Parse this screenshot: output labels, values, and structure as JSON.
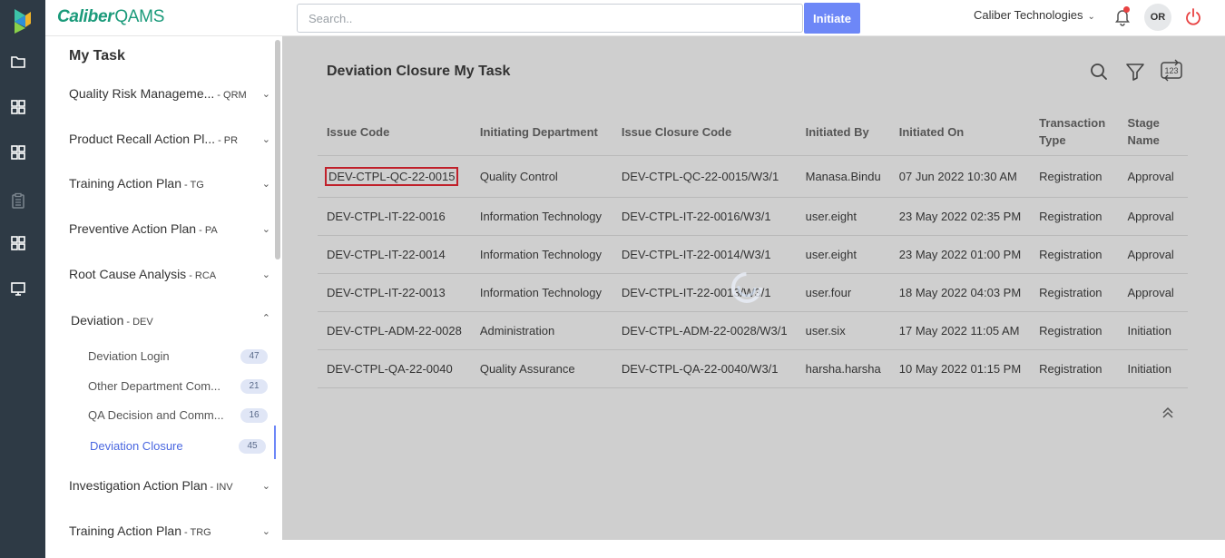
{
  "app": {
    "brand_main": "Caliber",
    "brand_sub": "QAMS"
  },
  "header": {
    "search_placeholder": "Search..",
    "initiate_label": "Initiate",
    "company": "Caliber Technologies",
    "avatar_initials": "OR"
  },
  "rail": {
    "icons": [
      "folder-icon",
      "grid-icon",
      "grid-icon",
      "clipboard-icon",
      "grid-icon",
      "monitor-icon"
    ]
  },
  "sidebar": {
    "title": "My Task",
    "modules": [
      {
        "label": "Quality Risk Manageme...",
        "abbr": "- QRM"
      },
      {
        "label": "Product Recall Action Pl...",
        "abbr": "- PR"
      },
      {
        "label": "Training Action Plan",
        "abbr": "- TG"
      },
      {
        "label": "Preventive Action Plan",
        "abbr": "- PA"
      },
      {
        "label": "Root Cause Analysis",
        "abbr": "- RCA"
      },
      {
        "label": "Deviation",
        "abbr": "- DEV"
      },
      {
        "label": "Investigation Action Plan",
        "abbr": "- INV"
      },
      {
        "label": "Training Action Plan",
        "abbr": "- TRG"
      }
    ],
    "deviation_items": [
      {
        "label": "Deviation Login",
        "count": "47"
      },
      {
        "label": "Other Department Com...",
        "count": "21"
      },
      {
        "label": "QA Decision and Comm...",
        "count": "16"
      },
      {
        "label": "Deviation Closure",
        "count": "45"
      }
    ]
  },
  "main": {
    "title": "Deviation Closure My Task",
    "columns": [
      "Issue Code",
      "Initiating Department",
      "Issue Closure Code",
      "Initiated By",
      "Initiated On",
      "Transaction Type",
      "Stage Name"
    ],
    "rows": [
      [
        "DEV-CTPL-QC-22-0015",
        "Quality Control",
        "DEV-CTPL-QC-22-0015/W3/1",
        "Manasa.Bindu",
        "07 Jun 2022 10:30 AM",
        "Registration",
        "Approval"
      ],
      [
        "DEV-CTPL-IT-22-0016",
        "Information Technology",
        "DEV-CTPL-IT-22-0016/W3/1",
        "user.eight",
        "23 May 2022 02:35 PM",
        "Registration",
        "Approval"
      ],
      [
        "DEV-CTPL-IT-22-0014",
        "Information Technology",
        "DEV-CTPL-IT-22-0014/W3/1",
        "user.eight",
        "23 May 2022 01:00 PM",
        "Registration",
        "Approval"
      ],
      [
        "DEV-CTPL-IT-22-0013",
        "Information Technology",
        "DEV-CTPL-IT-22-0013/W3/1",
        "user.four",
        "18 May 2022 04:03 PM",
        "Registration",
        "Approval"
      ],
      [
        "DEV-CTPL-ADM-22-0028",
        "Administration",
        "DEV-CTPL-ADM-22-0028/W3/1",
        "user.six",
        "17 May 2022 11:05 AM",
        "Registration",
        "Initiation"
      ],
      [
        "DEV-CTPL-QA-22-0040",
        "Quality Assurance",
        "DEV-CTPL-QA-22-0040/W3/1",
        "harsha.harsha",
        "10 May 2022 01:15 PM",
        "Registration",
        "Initiation"
      ]
    ]
  }
}
